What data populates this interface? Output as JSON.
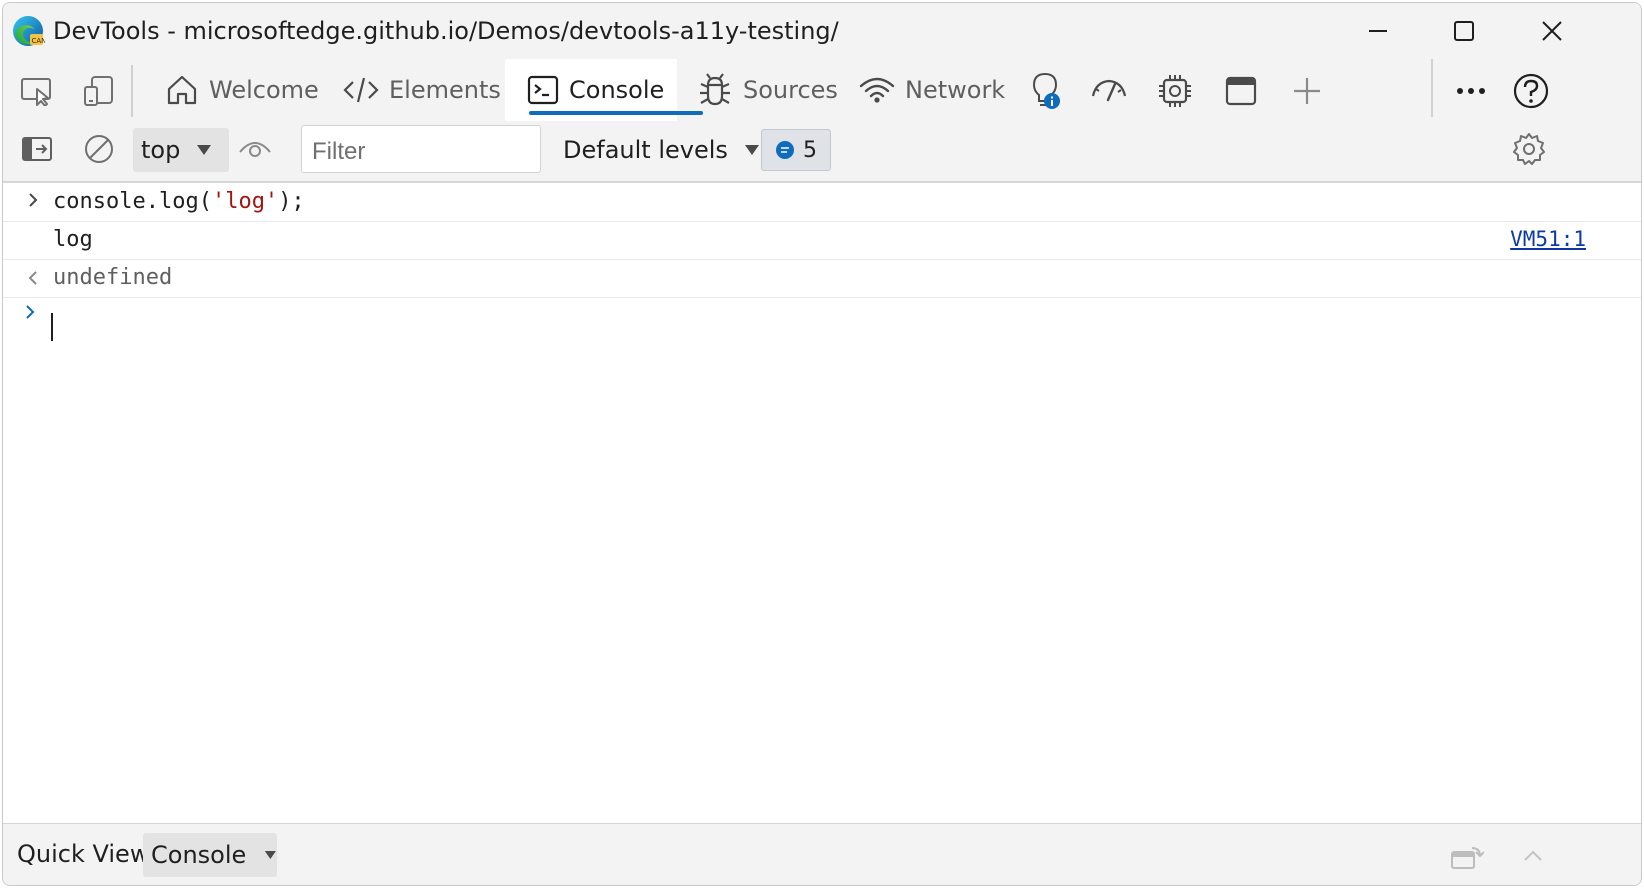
{
  "window": {
    "title": "DevTools - microsoftedge.github.io/Demos/devtools-a11y-testing/"
  },
  "tabs": [
    {
      "label": "Welcome",
      "icon": "home-icon"
    },
    {
      "label": "Elements",
      "icon": "code-brackets-icon"
    },
    {
      "label": "Console",
      "icon": "console-icon",
      "active": true
    },
    {
      "label": "Sources",
      "icon": "bug-icon"
    },
    {
      "label": "Network",
      "icon": "wifi-icon"
    }
  ],
  "toolbar": {
    "context": "top",
    "filter_placeholder": "Filter",
    "levels": "Default levels",
    "issues_count": "5"
  },
  "console": {
    "input_line": {
      "prefix": "console.log(",
      "string": "'log'",
      "suffix": ");"
    },
    "output_text": "log",
    "source_link": "VM51:1",
    "return_value": "undefined"
  },
  "quick_view": {
    "label": "Quick View:",
    "selected": "Console"
  },
  "colors": {
    "accent": "#0f6cbd",
    "string": "#a31515",
    "link": "#0b3aa8"
  }
}
